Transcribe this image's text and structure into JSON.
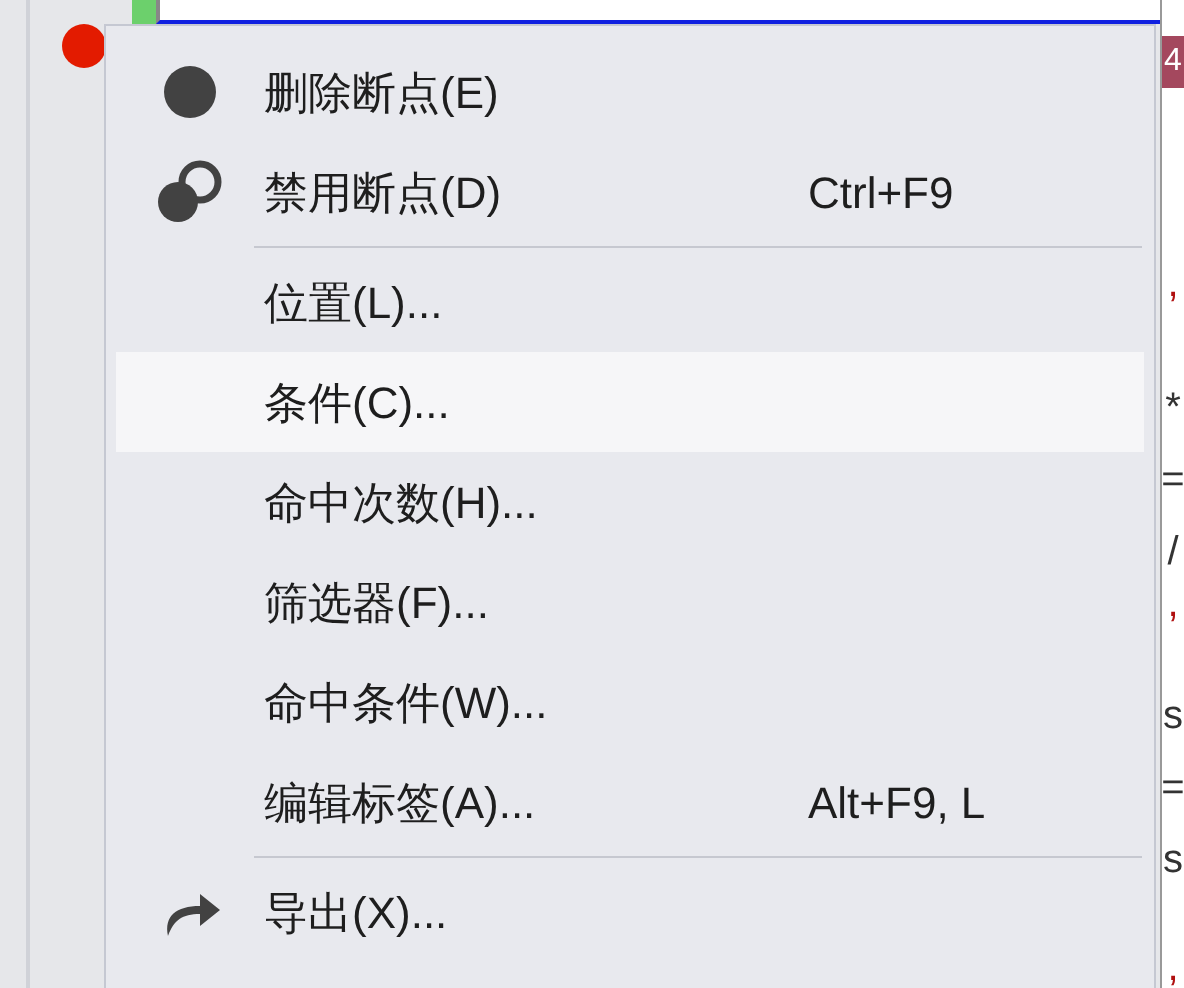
{
  "editor": {
    "badge": "4",
    "code_fragments": [
      ",",
      "*",
      "=",
      "/",
      ",",
      "s",
      "=",
      "s",
      ","
    ]
  },
  "context_menu": {
    "items": [
      {
        "kind": "item",
        "label": "删除断点(E)",
        "selected": false
      },
      {
        "kind": "item",
        "label": "禁用断点(D)",
        "shortcut": "Ctrl+F9",
        "selected": false
      },
      {
        "kind": "separator"
      },
      {
        "kind": "item",
        "label": "位置(L)...",
        "selected": false
      },
      {
        "kind": "item",
        "label": "条件(C)...",
        "selected": true
      },
      {
        "kind": "item",
        "label": "命中次数(H)...",
        "selected": false
      },
      {
        "kind": "item",
        "label": "筛选器(F)...",
        "selected": false
      },
      {
        "kind": "item",
        "label": "命中条件(W)...",
        "selected": false
      },
      {
        "kind": "item",
        "label": "编辑标签(A)...",
        "shortcut": "Alt+F9, L",
        "selected": false
      },
      {
        "kind": "separator"
      },
      {
        "kind": "item",
        "label": "导出(X)...",
        "selected": false
      }
    ]
  }
}
